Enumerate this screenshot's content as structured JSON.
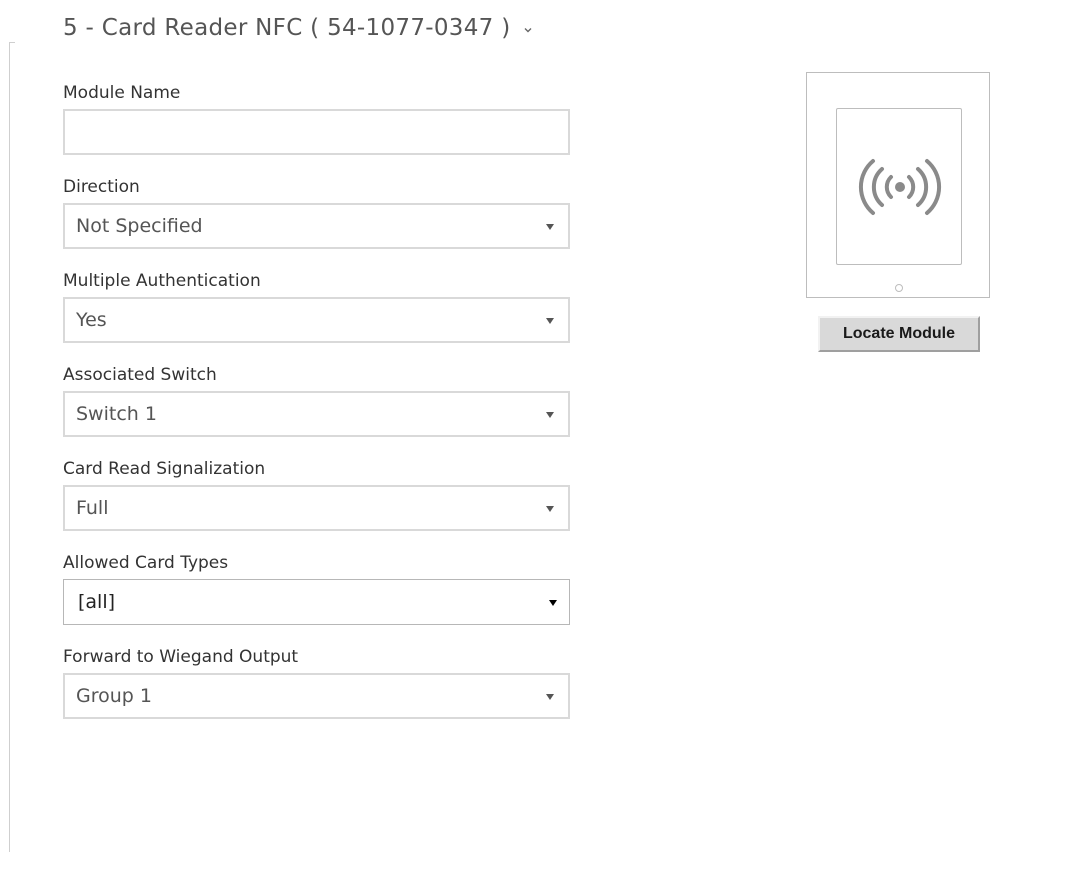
{
  "section": {
    "title": "5 - Card Reader NFC ( 54-1077-0347 )",
    "toggle_icon": "chevron-down-icon"
  },
  "fields": {
    "module_name": {
      "label": "Module Name",
      "value": "",
      "placeholder": ""
    },
    "direction": {
      "label": "Direction",
      "value": "Not Specified"
    },
    "multiple_authentication": {
      "label": "Multiple Authentication",
      "value": "Yes"
    },
    "associated_switch": {
      "label": "Associated Switch",
      "value": "Switch 1"
    },
    "card_read_signalization": {
      "label": "Card Read Signalization",
      "value": "Full"
    },
    "allowed_card_types": {
      "label": "Allowed Card Types",
      "value": "[all]"
    },
    "forward_to_wiegand_output": {
      "label": "Forward to Wiegand Output",
      "value": "Group 1"
    }
  },
  "preview": {
    "icon": "nfc-icon",
    "locate_button_label": "Locate Module"
  },
  "colors": {
    "border": "#d9d9d9",
    "text": "#333333",
    "muted_text": "#555555",
    "icon": "#8a8a8a",
    "button_bg": "#d9d9d9"
  }
}
